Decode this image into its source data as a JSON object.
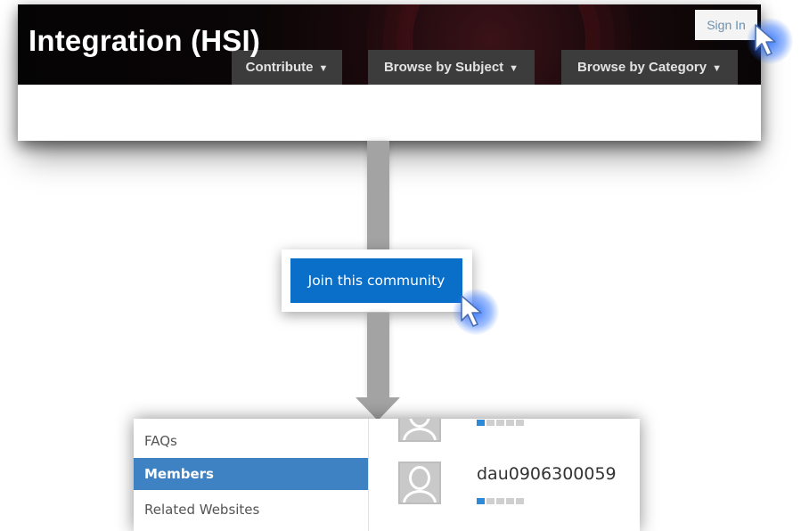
{
  "header": {
    "site_title": "Integration (HSI)",
    "sign_in_label": "Sign In",
    "nav": [
      {
        "label": "Contribute",
        "caret": "▼"
      },
      {
        "label": "Browse by Subject",
        "caret": "▼"
      },
      {
        "label": "Browse by Category",
        "caret": "▼"
      }
    ]
  },
  "join": {
    "button_label": "Join this community"
  },
  "sidebar": {
    "items": [
      {
        "label": "FAQs",
        "active": false
      },
      {
        "label": "Members",
        "active": true
      },
      {
        "label": "Related Websites",
        "active": false
      }
    ]
  },
  "members": [
    {
      "name": "",
      "rank_level": 1,
      "rank_max": 5
    },
    {
      "name": "dau0906300059",
      "rank_level": 1,
      "rank_max": 5
    }
  ],
  "colors": {
    "accent_blue": "#0a6fc9",
    "active_nav_blue": "#3f82c4",
    "header_dark": "#0a0506",
    "nav_button_gray": "#3c3c3c",
    "arrow_gray": "#a3a3a3",
    "cursor_glow": "#286eff"
  },
  "icons": [
    "pointer-cursor-icon",
    "down-arrow-icon",
    "default-avatar-icon",
    "caret-down-icon"
  ]
}
